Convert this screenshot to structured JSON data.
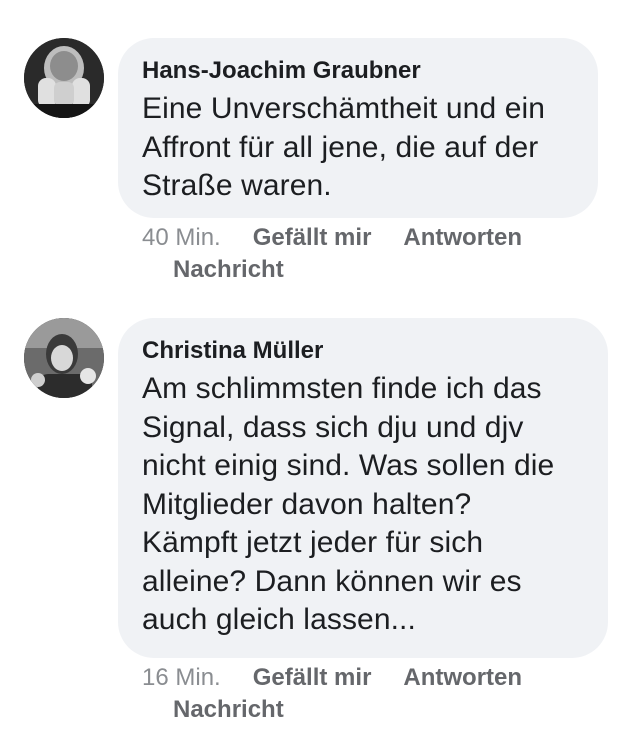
{
  "comments": [
    {
      "author": "Hans-Joachim Graubner",
      "text_lines": [
        "Eine Unverschämtheit und ein",
        "Affront für all jene, die auf der",
        "Straße waren."
      ],
      "time": "40 Min.",
      "like_label": "Gefällt mir",
      "reply_label": "Antworten",
      "message_label": "Nachricht",
      "avatar_icon": "person-avatar-bw"
    },
    {
      "author": "Christina Müller",
      "text_lines": [
        "Am schlimmsten finde ich das",
        "Signal, dass sich dju und djv",
        "nicht einig sind. Was sollen die",
        "Mitglieder davon halten?",
        "Kämpft jetzt jeder für sich",
        "alleine? Dann können wir es",
        "auch gleich lassen..."
      ],
      "time": "16 Min.",
      "like_label": "Gefällt mir",
      "reply_label": "Antworten",
      "message_label": "Nachricht",
      "avatar_icon": "person-avatar-bw"
    }
  ],
  "colors": {
    "bubble_bg": "#f0f2f5",
    "text": "#1c1e21",
    "meta": "#65676b"
  }
}
